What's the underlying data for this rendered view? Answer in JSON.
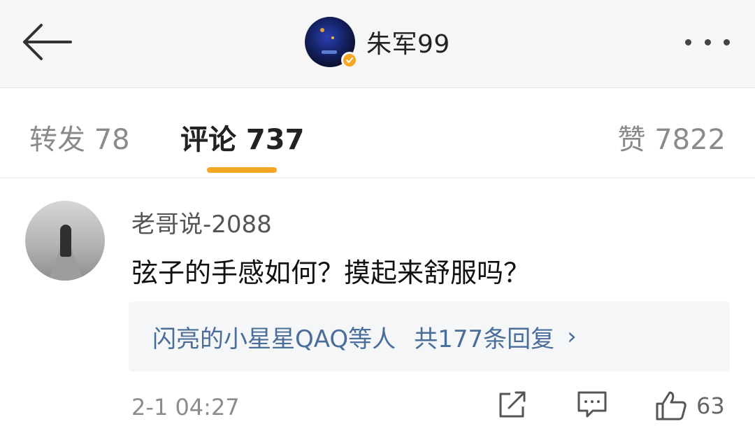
{
  "header": {
    "back_icon": "arrow-left-icon",
    "username": "朱军99",
    "verified_color": "#f5a623",
    "more_icon": "more-dots-icon"
  },
  "tabs": {
    "repost": "转发 78",
    "comments": "评论 737",
    "likes": "赞 7822",
    "active": "comments",
    "accent_color": "#f5a623"
  },
  "comment": {
    "author": "老哥说-2088",
    "text": "弦子的手感如何？摸起来舒服吗？",
    "replies": {
      "users": "闪亮的小星星QAQ等人",
      "count": "共177条回复",
      "chevron": "›"
    },
    "timestamp": "2-1 04:27",
    "like_count": "63",
    "actions": [
      "share-icon",
      "reply-icon",
      "like-icon"
    ]
  }
}
